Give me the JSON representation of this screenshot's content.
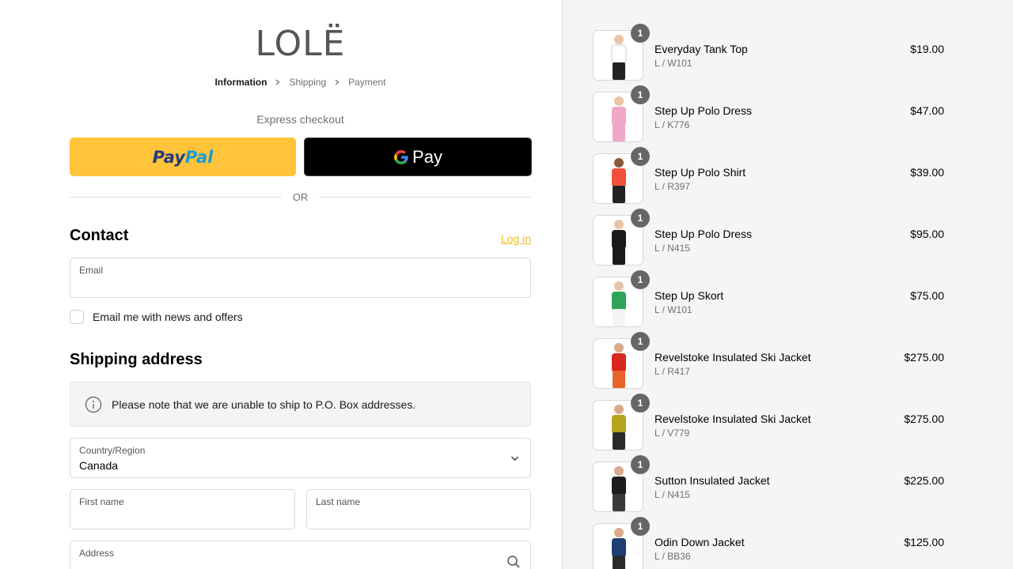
{
  "brand": {
    "logo_text": "LOLË"
  },
  "breadcrumb": [
    {
      "label": "Information",
      "active": true
    },
    {
      "label": "Shipping",
      "active": false
    },
    {
      "label": "Payment",
      "active": false
    }
  ],
  "express": {
    "label": "Express checkout",
    "paypal_part1": "Pay",
    "paypal_part2": "Pal",
    "gpay_text": "Pay",
    "paypal_color": "#ffc439",
    "gpay_color": "#000000"
  },
  "divider": {
    "label": "OR"
  },
  "contact": {
    "title": "Contact",
    "login_label": "Log in",
    "email_label": "Email",
    "email_value": "",
    "newsletter_label": "Email me with news and offers",
    "newsletter_checked": false
  },
  "shipping": {
    "title": "Shipping address",
    "notice": "Please note that we are unable to ship to P.O. Box addresses.",
    "country_label": "Country/Region",
    "country_value": "Canada",
    "first_name_label": "First name",
    "last_name_label": "Last name",
    "address_label": "Address"
  },
  "accent_color": "#f2b91b",
  "cart": {
    "items": [
      {
        "name": "Everyday Tank Top",
        "variant": "L / W101",
        "price": "$19.00",
        "qty": "1",
        "top_color": "#ffffff",
        "bottom_color": "#222222",
        "skin": "#e9c4a6"
      },
      {
        "name": "Step Up Polo Dress",
        "variant": "L / K776",
        "price": "$47.00",
        "qty": "1",
        "top_color": "#f0a8c8",
        "bottom_color": "#f0a8c8",
        "skin": "#e9c4a6"
      },
      {
        "name": "Step Up Polo Shirt",
        "variant": "L / R397",
        "price": "$39.00",
        "qty": "1",
        "top_color": "#f0503c",
        "bottom_color": "#222222",
        "skin": "#8a5a3c"
      },
      {
        "name": "Step Up Polo Dress",
        "variant": "L / N415",
        "price": "$95.00",
        "qty": "1",
        "top_color": "#1a1a1a",
        "bottom_color": "#1a1a1a",
        "skin": "#e9c4a6"
      },
      {
        "name": "Step Up Skort",
        "variant": "L / W101",
        "price": "$75.00",
        "qty": "1",
        "top_color": "#2fa35a",
        "bottom_color": "#f4f4f4",
        "skin": "#e9c4a6"
      },
      {
        "name": "Revelstoke Insulated Ski Jacket",
        "variant": "L / R417",
        "price": "$275.00",
        "qty": "1",
        "top_color": "#d8281e",
        "bottom_color": "#e8642a",
        "skin": "#d9a98a"
      },
      {
        "name": "Revelstoke Insulated Ski Jacket",
        "variant": "L / V779",
        "price": "$275.00",
        "qty": "1",
        "top_color": "#b5a41c",
        "bottom_color": "#2a2a2a",
        "skin": "#d9a98a"
      },
      {
        "name": "Sutton Insulated Jacket",
        "variant": "L / N415",
        "price": "$225.00",
        "qty": "1",
        "top_color": "#1c1c1c",
        "bottom_color": "#3a3a3a",
        "skin": "#d9a98a"
      },
      {
        "name": "Odin Down Jacket",
        "variant": "L / BB36",
        "price": "$125.00",
        "qty": "1",
        "top_color": "#1f3f72",
        "bottom_color": "#2a2a2a",
        "skin": "#d9a98a"
      }
    ]
  }
}
